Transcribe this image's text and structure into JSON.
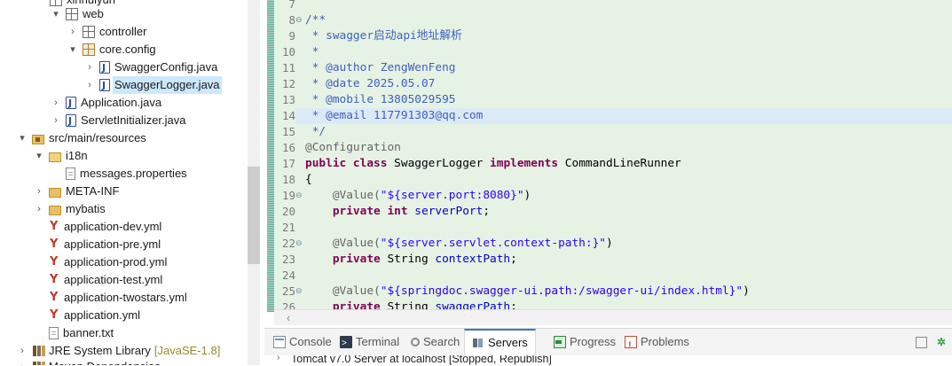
{
  "explorer": {
    "top_partial_label": "xinhuiyun",
    "items": [
      {
        "label": "web",
        "toggle": "▾",
        "icon": "package-icon"
      },
      {
        "label": "controller",
        "toggle": "›",
        "icon": "package-icon"
      },
      {
        "label": "core.config",
        "toggle": "▾",
        "icon": "package-icon"
      },
      {
        "label": "SwaggerConfig.java",
        "toggle": "›",
        "icon": "java-file-icon"
      },
      {
        "label": "SwaggerLogger.java",
        "toggle": "›",
        "icon": "java-file-icon",
        "selected": true
      },
      {
        "label": "Application.java",
        "toggle": "›",
        "icon": "java-file-icon"
      },
      {
        "label": "ServletInitializer.java",
        "toggle": "›",
        "icon": "java-file-icon"
      },
      {
        "label": "src/main/resources",
        "toggle": "▾",
        "icon": "source-folder-icon"
      },
      {
        "label": "i18n",
        "toggle": "▾",
        "icon": "folder-icon"
      },
      {
        "label": "messages.properties",
        "toggle": "",
        "icon": "properties-file-icon"
      },
      {
        "label": "META-INF",
        "toggle": "›",
        "icon": "folder-icon"
      },
      {
        "label": "mybatis",
        "toggle": "›",
        "icon": "folder-icon"
      },
      {
        "label": "application-dev.yml",
        "toggle": "",
        "icon": "yml-file-icon"
      },
      {
        "label": "application-pre.yml",
        "toggle": "",
        "icon": "yml-file-icon"
      },
      {
        "label": "application-prod.yml",
        "toggle": "",
        "icon": "yml-file-icon"
      },
      {
        "label": "application-test.yml",
        "toggle": "",
        "icon": "yml-file-icon"
      },
      {
        "label": "application-twostars.yml",
        "toggle": "",
        "icon": "yml-file-icon"
      },
      {
        "label": "application.yml",
        "toggle": "",
        "icon": "yml-file-icon"
      },
      {
        "label": "banner.txt",
        "toggle": "",
        "icon": "text-file-icon"
      },
      {
        "label": "JRE System Library",
        "decoration": "[JavaSE-1.8]",
        "toggle": "›",
        "icon": "library-icon"
      }
    ],
    "bottom_partial_label": "Maven Dependencies"
  },
  "editor": {
    "line_numbers": [
      "7",
      "8",
      "9",
      "10",
      "11",
      "12",
      "13",
      "14",
      "15",
      "16",
      "17",
      "18",
      "19",
      "20",
      "21",
      "22",
      "23",
      "24",
      "25",
      "26"
    ],
    "fold_markers": {
      "8": "⊖",
      "19": "⊖",
      "22": "⊖",
      "25": "⊖"
    },
    "current_line": "14",
    "lines": {
      "7": "",
      "8": "/**",
      "9": " * swagger启动api地址解析",
      "10": " *",
      "11": " * @author ZengWenFeng",
      "12": " * @date 2025.05.07",
      "13": " * @mobile 13805029595",
      "14": " * @email 117791303@qq.com",
      "15": " */",
      "16": "@Configuration",
      "17_kw1": "public class",
      "17_mid": " SwaggerLogger ",
      "17_kw2": "implements",
      "17_end": " CommandLineRunner",
      "18": "{",
      "19_ann": "    @Value(",
      "19_str": "\"${server.port:8080}\"",
      "19_end": ")",
      "20_kw": "    private int",
      "20_fld": " serverPort",
      "20_end": ";",
      "21": "",
      "22_ann": "    @Value(",
      "22_str": "\"${server.servlet.context-path:}\"",
      "22_end": ")",
      "23_kw": "    private",
      "23_type": " String ",
      "23_fld": "contextPath",
      "23_end": ";",
      "24": "",
      "25_ann": "    @Value(",
      "25_str": "\"${springdoc.swagger-ui.path:/swagger-ui/index.html}\"",
      "25_end": ")",
      "26_kw": "    private",
      "26_type": " String ",
      "26_fld": "swaggerPath",
      "26_end": ";"
    },
    "hscroll_arrow": "‹"
  },
  "bottom_panel": {
    "tabs": [
      {
        "label": "Console",
        "icon": "console-icon"
      },
      {
        "label": "Terminal",
        "icon": "terminal-icon"
      },
      {
        "label": "Search",
        "icon": "search-icon"
      },
      {
        "label": "Servers",
        "icon": "servers-icon",
        "active": true
      },
      {
        "label": "Progress",
        "icon": "progress-icon"
      },
      {
        "label": "Problems",
        "icon": "problems-icon"
      }
    ],
    "server_row": "Tomcat v7.0 Server at localhost  [Stopped, Republish]"
  },
  "colors": {
    "editor_bg": "#e6f3e4",
    "keyword": "#7f0055",
    "string": "#2a00ff",
    "javadoc": "#3f5fbf",
    "annotation": "#646464",
    "selection": "#cce8ff"
  }
}
